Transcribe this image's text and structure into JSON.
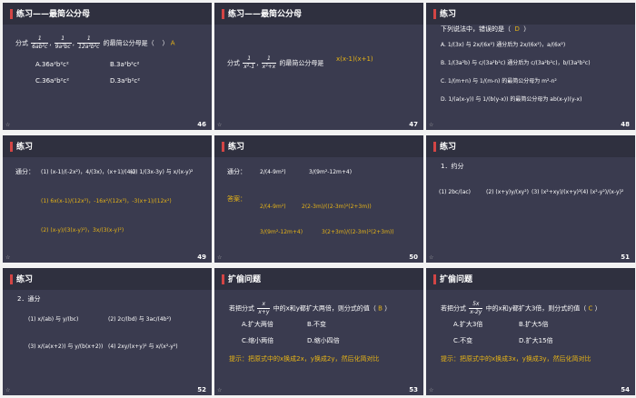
{
  "slides": [
    {
      "title": "练习——最简公分母",
      "page": "46",
      "stem": "分式",
      "stem2": "的最简公分母是（",
      "stem3": "）",
      "answer": "A",
      "f1n": "1",
      "f1d": "6ab²c",
      "f2n": "1",
      "f2d": "9a²bc",
      "f3n": "1",
      "f3d": "12a²b²c",
      "opts": [
        "A.36a²b²c²",
        "B.3a²b²c²",
        "C.36a²b²c²",
        "D.3a²b²c²"
      ]
    },
    {
      "title": "练习——最简公分母",
      "page": "47",
      "stem": "分式",
      "stem2": "的最简公分母是",
      "answer": "x(x-1)(x+1)",
      "f1n": "1",
      "f1d": "x²-1",
      "f2n": "1",
      "f2d": "x²+x"
    },
    {
      "title": "练习",
      "page": "48",
      "stem": "下列说法中，错误的是（",
      "answer": "D",
      "stem3": "）",
      "lines": [
        "A. 1/(3x) 与 2x/(6x²) 通分后为 2x/(6x²)，a/(6x²)",
        "B. 1/(3a²b) 与 c/(3a²b²c) 通分后为 c/(3a²b²c)，b/(3a²b²c)",
        "C. 1/(m+n) 与 1/(m-n) 的最简公分母为 m²-n²",
        "D. 1/(a(x-y)) 与 1/(b(y-x)) 的最简公分母为 ab(x-y)(y-x)"
      ]
    },
    {
      "title": "练习",
      "page": "49",
      "label": "通分：",
      "q1": "(1) (x-1)/(-2x²)，4/(3x)，(x+1)/(4x)",
      "q2": "(2) 1/(3x-3y) 与 x/(x-y)²",
      "a1": "(1) 6x(x-1)/(12x³)，-16x²/(12x³)，-3(x+1)/(12x²)",
      "a2": "(2) (x-y)/(3(x-y)²)，3x/(3(x-y)²)"
    },
    {
      "title": "练习",
      "page": "50",
      "label": "通分：",
      "ans_label": "答案：",
      "q1": "2/(4-9m²)",
      "q2": "3/(9m²-12m+4)",
      "a1l": "2/(4-9m²)",
      "a1r": "2(2-3m)/((2-3m)²(2+3m))",
      "a2l": "3/(9m²-12m+4)",
      "a2r": "3(2+3m)/((2-3m)²(2+3m))"
    },
    {
      "title": "练习",
      "page": "51",
      "heading": "1．约分",
      "items": [
        "(1) 2bc/(ac)",
        "(2) (x+y)y/(xy²)",
        "(3) (x²+xy)/(x+y)²",
        "(4) (x²-y²)/(x-y)²"
      ]
    },
    {
      "title": "练习",
      "page": "52",
      "heading": "2．通分",
      "items": [
        "(1) x/(ab) 与 y/(bc)",
        "(2) 2c/(bd) 与 3ac/(4b²)",
        "(3) x/(a(x+2)) 与 y/(b(x+2))",
        "(4) 2xy/(x+y)² 与 x/(x²-y²)"
      ]
    },
    {
      "title": "扩偷问题",
      "page": "53",
      "stem": "若把分式",
      "frac_n": "x",
      "frac_d": "x+y",
      "stem2": "中的x和y都扩大两倍，则分式的值（",
      "answer": "B",
      "stem3": "）",
      "opts": [
        "A.扩大两倍",
        "B.不变",
        "C.缩小两倍",
        "D.缩小四倍"
      ],
      "hint": "提示：把原式中的x换成2x，y换成2y，然后化简对比"
    },
    {
      "title": "扩偷问题",
      "page": "54",
      "stem": "若把分式",
      "frac_n": "5x",
      "frac_d": "x-2y",
      "stem2": "中的x和y都扩大3倍，则分式的值（",
      "answer": "C",
      "stem3": "）",
      "opts": [
        "A.扩大3倍",
        "B.扩大5倍",
        "C.不变",
        "D.扩大15倍"
      ],
      "hint": "提示：把原式中的x换成3x，y换成3y，然后化简对比"
    }
  ],
  "star": "☆"
}
